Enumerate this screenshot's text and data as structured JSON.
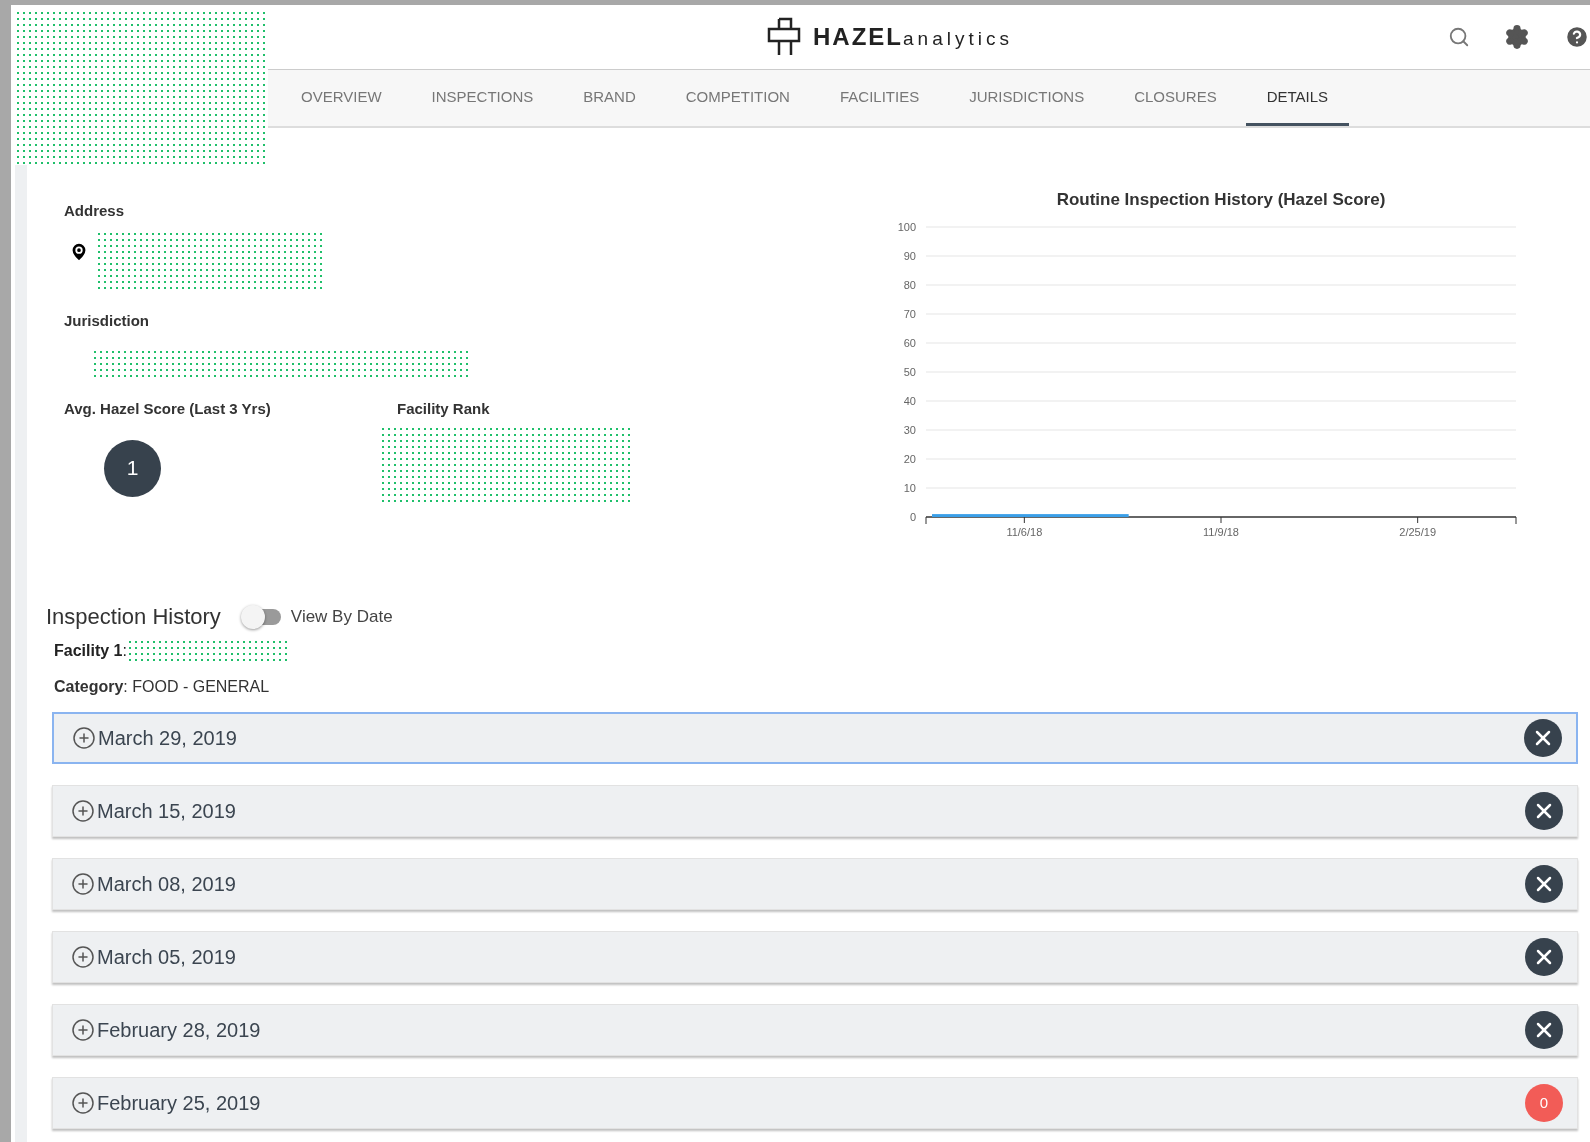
{
  "header": {
    "logo_bold": "HAZEL",
    "logo_light": "analytics"
  },
  "tabs": [
    {
      "label": "OVERVIEW",
      "selected": false
    },
    {
      "label": "INSPECTIONS",
      "selected": false
    },
    {
      "label": "BRAND",
      "selected": false
    },
    {
      "label": "COMPETITION",
      "selected": false
    },
    {
      "label": "FACILITIES",
      "selected": false
    },
    {
      "label": "JURISDICTIONS",
      "selected": false
    },
    {
      "label": "CLOSURES",
      "selected": false
    },
    {
      "label": "DETAILS",
      "selected": true
    }
  ],
  "details": {
    "address_label": "Address",
    "jurisdiction_label": "Jurisdiction",
    "avg_score_label": "Avg. Hazel Score (Last 3 Yrs)",
    "avg_score": "1",
    "rank_label": "Facility Rank"
  },
  "chart": {
    "chart_data": {
      "type": "bar",
      "title": "Routine Inspection History (Hazel Score)",
      "categories": [
        "11/6/18",
        "11/9/18",
        "2/25/19"
      ],
      "series": [
        {
          "color": "#3a9fe8",
          "values": [
            1,
            null,
            null
          ]
        }
      ],
      "grid": true,
      "ylim": [
        0,
        100
      ],
      "yticks": [
        0,
        10,
        20,
        30,
        40,
        50,
        60,
        70,
        80,
        90,
        100
      ]
    }
  },
  "history": {
    "title": "Inspection History",
    "toggle": {
      "label": "View By Date",
      "on": false
    },
    "facility_label": "**Facility 1**:",
    "category_text": "**Category**: FOOD - GENERAL",
    "rows": [
      {
        "date": "March 29, 2019",
        "selected": true,
        "kind": "closed"
      },
      {
        "date": "March 15, 2019",
        "selected": false,
        "kind": "closed"
      },
      {
        "date": "March 08, 2019",
        "selected": false,
        "kind": "closed"
      },
      {
        "date": "March 05, 2019",
        "selected": false,
        "kind": "closed"
      },
      {
        "date": "February 28, 2019",
        "selected": false,
        "kind": "closed"
      },
      {
        "date": "February 25, 2019",
        "selected": false,
        "kind": "score",
        "score": "0"
      }
    ]
  }
}
